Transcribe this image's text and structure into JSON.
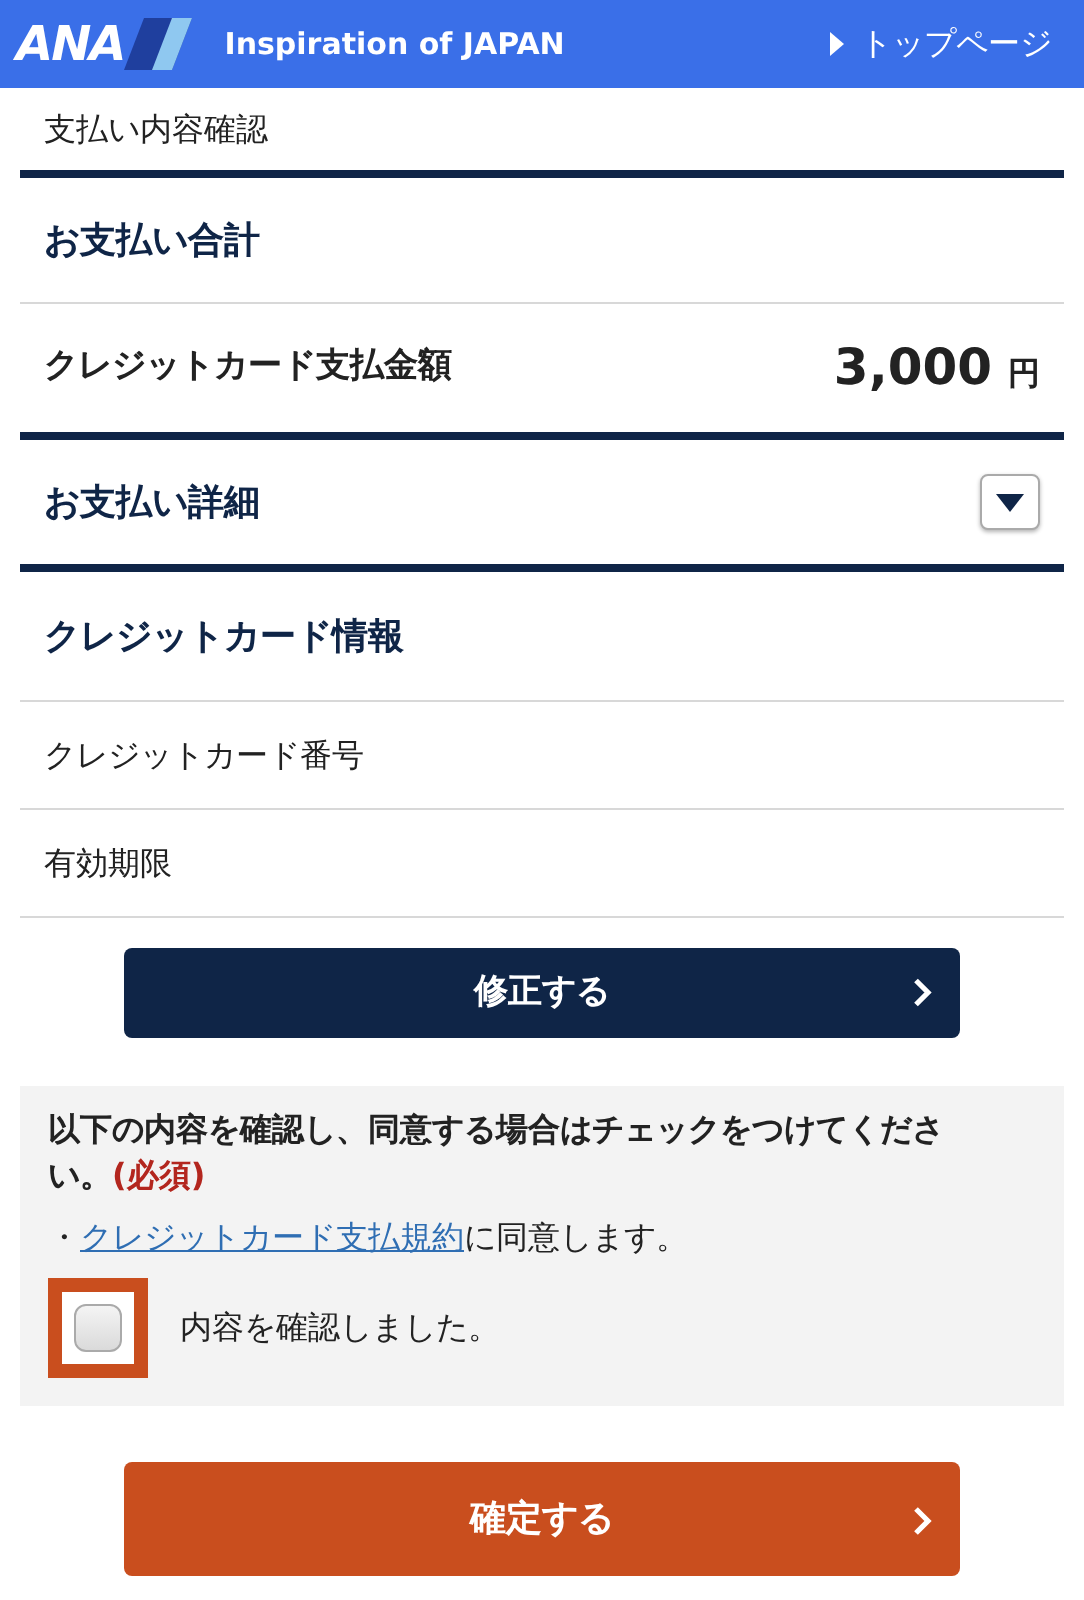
{
  "header": {
    "logo_text": "ANA",
    "tagline": "Inspiration of JAPAN",
    "top_link": "トップページ"
  },
  "breadcrumb": "支払い内容確認",
  "total_section": {
    "title": "お支払い合計",
    "label": "クレジットカード支払金額",
    "amount": "3,000",
    "unit": "円"
  },
  "details_section": {
    "title": "お支払い詳細",
    "expanded": false
  },
  "card_section": {
    "title": "クレジットカード情報",
    "rows": [
      {
        "label": "クレジットカード番号"
      },
      {
        "label": "有効期限"
      }
    ]
  },
  "edit_button": "修正する",
  "agreement": {
    "instruction": "以下の内容を確認し、同意する場合はチェックをつけてください。",
    "required": "(必須)",
    "bullet": "・",
    "link": "クレジットカード支払規約",
    "link_suffix": "に同意します。",
    "checkbox_label": "内容を確認しました。",
    "checked": false
  },
  "confirm_button": "確定する"
}
